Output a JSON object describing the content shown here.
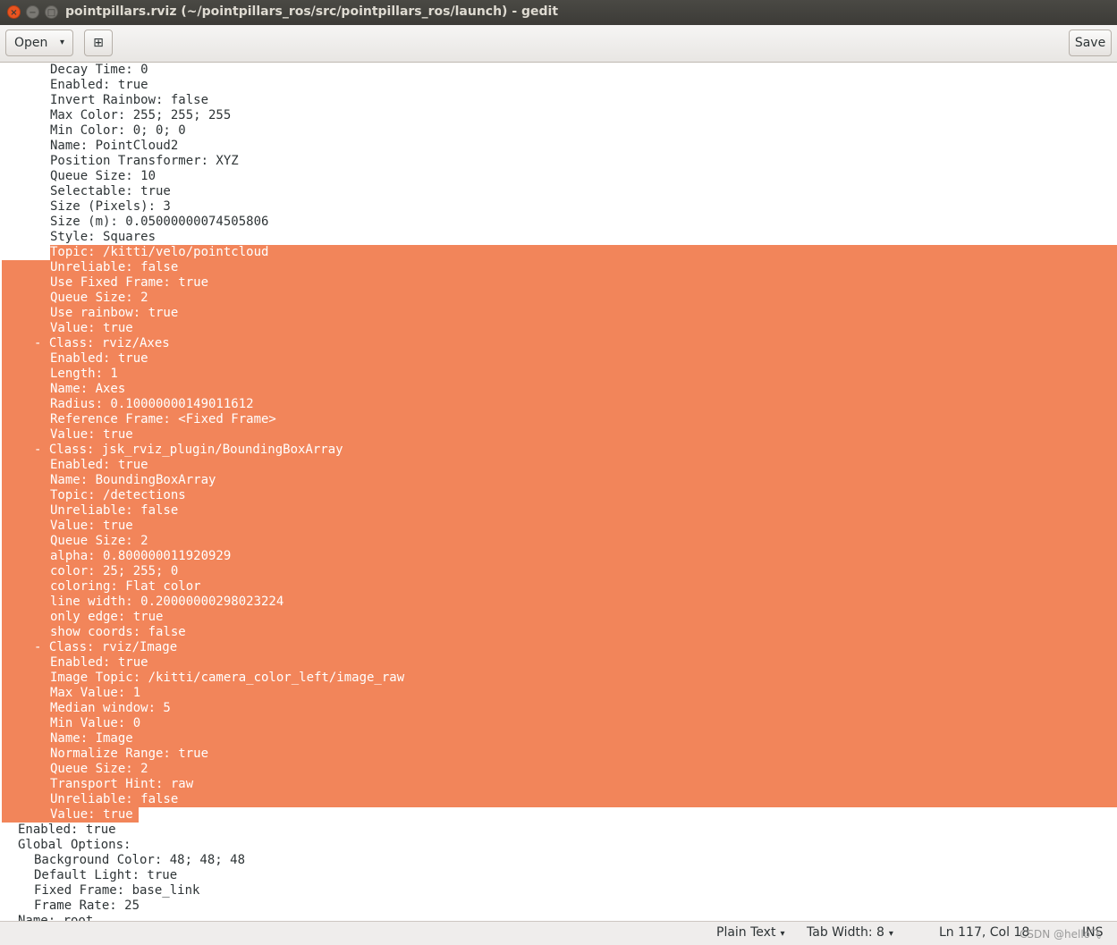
{
  "window": {
    "title": "pointpillars.rviz (~/pointpillars_ros/src/pointpillars_ros/launch) - gedit",
    "close_glyph": "×",
    "minimize_glyph": "−",
    "maximize_glyph": "□"
  },
  "header": {
    "open_label": "Open",
    "open_caret": "▾",
    "new_doc_glyph": "⊞",
    "save_label": "Save"
  },
  "editor": {
    "selection_color": "#f2855a",
    "lines": [
      {
        "text": "Decay Time: 0",
        "indent": 6
      },
      {
        "text": "Enabled: true",
        "indent": 6
      },
      {
        "text": "Invert Rainbow: false",
        "indent": 6
      },
      {
        "text": "Max Color: 255; 255; 255",
        "indent": 6
      },
      {
        "text": "Min Color: 0; 0; 0",
        "indent": 6
      },
      {
        "text": "Name: PointCloud2",
        "indent": 6
      },
      {
        "text": "Position Transformer: XYZ",
        "indent": 6
      },
      {
        "text": "Queue Size: 10",
        "indent": 6
      },
      {
        "text": "Selectable: true",
        "indent": 6
      },
      {
        "text": "Size (Pixels): 3",
        "indent": 6
      },
      {
        "text": "Size (m): 0.05000000074505806",
        "indent": 6
      },
      {
        "text": "Style: Squares",
        "indent": 6
      },
      {
        "text": "Topic: /kitti/velo/pointcloud",
        "indent": 6,
        "sel": "first"
      },
      {
        "text": "Unreliable: false",
        "indent": 6,
        "sel": "full"
      },
      {
        "text": "Use Fixed Frame: true",
        "indent": 6,
        "sel": "full"
      },
      {
        "text": "Queue Size: 2",
        "indent": 6,
        "sel": "full"
      },
      {
        "text": "Use rainbow: true",
        "indent": 6,
        "sel": "full"
      },
      {
        "text": "Value: true",
        "indent": 6,
        "sel": "full"
      },
      {
        "text": "- Class: rviz/Axes",
        "indent": 4,
        "sel": "full"
      },
      {
        "text": "Enabled: true",
        "indent": 6,
        "sel": "full"
      },
      {
        "text": "Length: 1",
        "indent": 6,
        "sel": "full"
      },
      {
        "text": "Name: Axes",
        "indent": 6,
        "sel": "full"
      },
      {
        "text": "Radius: 0.10000000149011612",
        "indent": 6,
        "sel": "full"
      },
      {
        "text": "Reference Frame: <Fixed Frame>",
        "indent": 6,
        "sel": "full"
      },
      {
        "text": "Value: true",
        "indent": 6,
        "sel": "full"
      },
      {
        "text": "- Class: jsk_rviz_plugin/BoundingBoxArray",
        "indent": 4,
        "sel": "full"
      },
      {
        "text": "Enabled: true",
        "indent": 6,
        "sel": "full"
      },
      {
        "text": "Name: BoundingBoxArray",
        "indent": 6,
        "sel": "full"
      },
      {
        "text": "Topic: /detections",
        "indent": 6,
        "sel": "full"
      },
      {
        "text": "Unreliable: false",
        "indent": 6,
        "sel": "full"
      },
      {
        "text": "Value: true",
        "indent": 6,
        "sel": "full"
      },
      {
        "text": "Queue Size: 2",
        "indent": 6,
        "sel": "full"
      },
      {
        "text": "alpha: 0.800000011920929",
        "indent": 6,
        "sel": "full"
      },
      {
        "text": "color: 25; 255; 0",
        "indent": 6,
        "sel": "full"
      },
      {
        "text": "coloring: Flat color",
        "indent": 6,
        "sel": "full"
      },
      {
        "text": "line width: 0.20000000298023224",
        "indent": 6,
        "sel": "full"
      },
      {
        "text": "only edge: true",
        "indent": 6,
        "sel": "full"
      },
      {
        "text": "show coords: false",
        "indent": 6,
        "sel": "full"
      },
      {
        "text": "- Class: rviz/Image",
        "indent": 4,
        "sel": "full"
      },
      {
        "text": "Enabled: true",
        "indent": 6,
        "sel": "full"
      },
      {
        "text": "Image Topic: /kitti/camera_color_left/image_raw",
        "indent": 6,
        "sel": "full"
      },
      {
        "text": "Max Value: 1",
        "indent": 6,
        "sel": "full"
      },
      {
        "text": "Median window: 5",
        "indent": 6,
        "sel": "full"
      },
      {
        "text": "Min Value: 0",
        "indent": 6,
        "sel": "full"
      },
      {
        "text": "Name: Image",
        "indent": 6,
        "sel": "full"
      },
      {
        "text": "Normalize Range: true",
        "indent": 6,
        "sel": "full"
      },
      {
        "text": "Queue Size: 2",
        "indent": 6,
        "sel": "full"
      },
      {
        "text": "Transport Hint: raw",
        "indent": 6,
        "sel": "full"
      },
      {
        "text": "Unreliable: false",
        "indent": 6,
        "sel": "full"
      },
      {
        "text": "Value: true",
        "indent": 6,
        "sel": "last"
      },
      {
        "text": "Enabled: true",
        "indent": 2
      },
      {
        "text": "Global Options:",
        "indent": 2
      },
      {
        "text": "Background Color: 48; 48; 48",
        "indent": 4
      },
      {
        "text": "Default Light: true",
        "indent": 4
      },
      {
        "text": "Fixed Frame: base_link",
        "indent": 4
      },
      {
        "text": "Frame Rate: 25",
        "indent": 4
      },
      {
        "text": "Name: root",
        "indent": 2
      }
    ]
  },
  "status": {
    "language": "Plain Text",
    "tab_width": "Tab Width: 8",
    "caret": "▾",
    "position": "Ln 117, Col 18",
    "mode": "INS",
    "watermark": "CSDN @hello飞"
  }
}
